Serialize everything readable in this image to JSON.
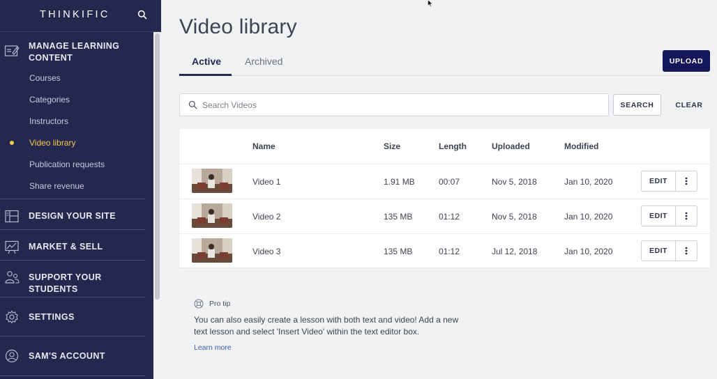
{
  "app": {
    "brand": "THINKIFIC"
  },
  "sidebar": {
    "sections": [
      {
        "label_line1": "MANAGE LEARNING",
        "label_line2": "CONTENT",
        "icon": "edit-content-icon"
      },
      {
        "label": "DESIGN YOUR SITE",
        "icon": "layout-icon"
      },
      {
        "label": "MARKET & SELL",
        "icon": "chart-board-icon"
      },
      {
        "label": "SUPPORT YOUR STUDENTS",
        "icon": "users-icon"
      },
      {
        "label": "SETTINGS",
        "icon": "gear-icon"
      },
      {
        "label": "SAM'S ACCOUNT",
        "icon": "user-circle-icon"
      }
    ],
    "items": [
      {
        "label": "Courses"
      },
      {
        "label": "Categories"
      },
      {
        "label": "Instructors"
      },
      {
        "label": "Video library",
        "active": true
      },
      {
        "label": "Publication requests"
      },
      {
        "label": "Share revenue"
      }
    ]
  },
  "main": {
    "title": "Video library",
    "tabs": [
      {
        "label": "Active",
        "active": true
      },
      {
        "label": "Archived"
      }
    ],
    "upload_label": "UPLOAD",
    "search": {
      "placeholder": "Search Videos",
      "button_label": "SEARCH",
      "clear_label": "CLEAR"
    },
    "table": {
      "columns": [
        "Name",
        "Size",
        "Length",
        "Uploaded",
        "Modified"
      ],
      "rows": [
        {
          "name": "Video 1",
          "size": "1.91 MB",
          "length": "00:07",
          "uploaded": "Nov 5, 2018",
          "modified": "Jan 10, 2020",
          "edit": "EDIT"
        },
        {
          "name": "Video 2",
          "size": "135 MB",
          "length": "01:12",
          "uploaded": "Nov 5, 2018",
          "modified": "Jan 10, 2020",
          "edit": "EDIT"
        },
        {
          "name": "Video 3",
          "size": "135 MB",
          "length": "01:12",
          "uploaded": "Jul 12, 2018",
          "modified": "Jan 10, 2020",
          "edit": "EDIT"
        }
      ]
    },
    "tip": {
      "label": "Pro tip",
      "text": "You can also easily create a lesson with both text and video! Add a new text lesson and select 'Insert Video' within the text editor box.",
      "link": "Learn more"
    }
  },
  "colors": {
    "sidebar_bg": "#24284f",
    "active_item": "#f5c94d",
    "primary_button": "#14185a",
    "link": "#3b5bb5"
  }
}
